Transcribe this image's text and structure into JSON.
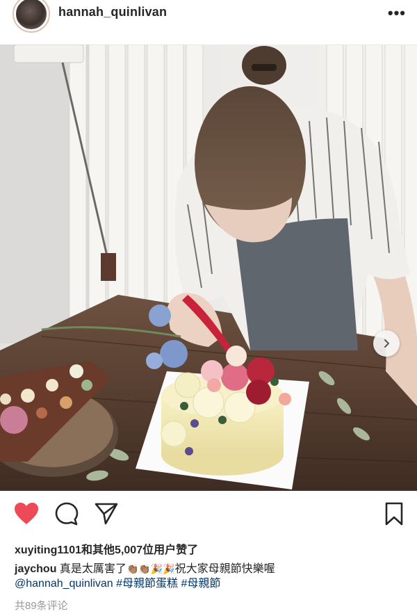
{
  "header": {
    "username": "hannah_quinlivan",
    "more": "•••"
  },
  "post": {
    "likes_text": "xuyiting1101和其他5,007位用户赞了",
    "caption_user": "jaychou",
    "caption_text": "真是太厲害了",
    "caption_emojis": "👏🏽👏🏽🎉🎉",
    "caption_text2": "祝大家母親節快樂喔",
    "mention": "@hannah_quinlivan",
    "hashtag1": "#母親節蛋糕",
    "hashtag2": "#母親節",
    "comments_text": "共89条评论"
  },
  "icons": {
    "like": "heart-icon",
    "comment": "comment-icon",
    "share": "paper-plane-icon",
    "save": "bookmark-icon",
    "next": "chevron-right-icon"
  },
  "colors": {
    "heart": "#ed4956",
    "link": "#003569",
    "muted": "#999999"
  }
}
